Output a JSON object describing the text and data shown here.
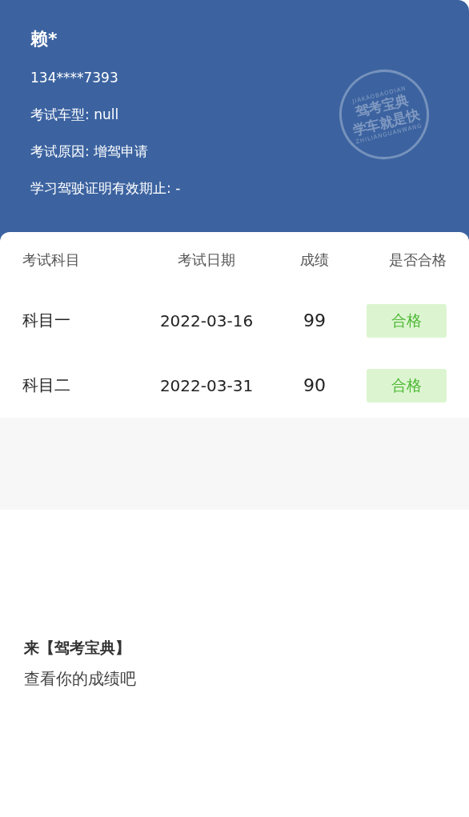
{
  "header": {
    "name": "赖*",
    "phone": "134****7393",
    "fields": [
      {
        "label": "考试车型:",
        "value": "null"
      },
      {
        "label": "考试原因:",
        "value": "增驾申请"
      },
      {
        "label": "学习驾驶证明有效期止:",
        "value": "-"
      }
    ],
    "seal": {
      "top": "JIAKAOBAODIAN",
      "lines": [
        "驾考宝典",
        "学车就是快"
      ],
      "bottom": "ZHILIANGUANWANG"
    }
  },
  "table": {
    "columns": [
      "考试科目",
      "考试日期",
      "成绩",
      "是否合格"
    ],
    "rows": [
      {
        "subject": "科目一",
        "date": "2022-03-16",
        "score": "99",
        "result": "合格",
        "passed": true
      },
      {
        "subject": "科目二",
        "date": "2022-03-31",
        "score": "90",
        "result": "合格",
        "passed": true
      }
    ]
  },
  "promo": {
    "title": "来【驾考宝典】",
    "subtitle": "查看你的成绩吧"
  }
}
